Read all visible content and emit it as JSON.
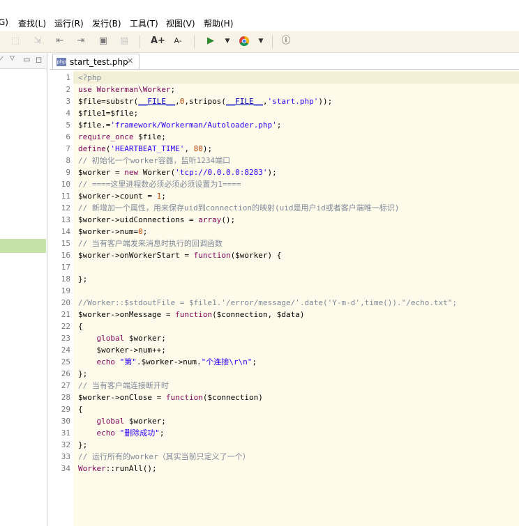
{
  "menu": {
    "items": [
      "G)",
      "查找(L)",
      "运行(R)",
      "发行(B)",
      "工具(T)",
      "视图(V)",
      "帮助(H)"
    ]
  },
  "toolbar": {
    "icons": [
      "format-icon",
      "export-icon",
      "step-back-icon",
      "step-forward-icon",
      "save-page-icon",
      "save-disabled-icon",
      "font-larger-icon",
      "font-smaller-icon",
      "run-icon",
      "run-dropdown-icon",
      "browser-icon",
      "browser-dropdown-icon",
      "info-icon"
    ],
    "font_larger": "A+",
    "font_smaller": "A-"
  },
  "tab": {
    "file_name": "start_test.php",
    "file_type": "php",
    "close_glyph": "✕"
  },
  "editor": {
    "lines": [
      {
        "n": "1",
        "html": "<span class='cmt-gray'>&lt;?php</span>"
      },
      {
        "n": "2",
        "html": "<span class='kw'>use</span> <span class='cls'>Workerman\\Worker</span>;"
      },
      {
        "n": "3",
        "html": "$file=substr(<span class='const'>__FILE__</span>,<span class='num'>0</span>,stripos(<span class='const'>__FILE__</span>,<span class='str'>'start.php'</span>));"
      },
      {
        "n": "4",
        "html": "$file1=$file;"
      },
      {
        "n": "5",
        "html": "$file.=<span class='str'>'framework/Workerman/Autoloader.php'</span>;"
      },
      {
        "n": "6",
        "html": "<span class='kw'>require_once</span> $file;"
      },
      {
        "n": "7",
        "html": "<span class='kw'>define</span>(<span class='str'>'HEARTBEAT_TIME'</span>, <span class='num'>80</span>);"
      },
      {
        "n": "8",
        "html": "<span class='cmt-gray'>// 初始化一个worker容器，监听1234端口</span>"
      },
      {
        "n": "9",
        "html": "$worker = <span class='kw'>new</span> Worker(<span class='str'>'tcp://0.0.0.0:8283'</span>);"
      },
      {
        "n": "10",
        "html": "<span class='cmt-gray'>// ====这里进程数必须必须必须设置为1====</span>"
      },
      {
        "n": "11",
        "html": "$worker-&gt;count = <span class='num'>1</span>;"
      },
      {
        "n": "12",
        "html": "<span class='cmt-gray'>// 新增加一个属性，用来保存uid到connection的映射(uid是用户id或者客户端唯一标识)</span>"
      },
      {
        "n": "13",
        "html": "$worker-&gt;uidConnections = <span class='kw'>array</span>();"
      },
      {
        "n": "14",
        "html": "$worker-&gt;num=<span class='num'>0</span>;"
      },
      {
        "n": "15",
        "html": "<span class='cmt-gray'>// 当有客户端发来消息时执行的回调函数</span>"
      },
      {
        "n": "16",
        "html": "$worker-&gt;onWorkerStart = <span class='kw'>function</span>($worker) {"
      },
      {
        "n": "17",
        "html": ""
      },
      {
        "n": "18",
        "html": "};"
      },
      {
        "n": "19",
        "html": ""
      },
      {
        "n": "20",
        "html": "<span class='cmt-gray'>//Worker::$stdoutFile = $file1.'/error/message/'.date('Y-m-d',time()).\"/echo.txt\";</span>"
      },
      {
        "n": "21",
        "html": "$worker-&gt;onMessage = <span class='kw'>function</span>($connection, $data)"
      },
      {
        "n": "22",
        "html": "{"
      },
      {
        "n": "23",
        "html": "    <span class='kw'>global</span> $worker;"
      },
      {
        "n": "24",
        "html": "    $worker-&gt;num++;"
      },
      {
        "n": "25",
        "html": "    <span class='kw'>echo</span> <span class='str'>\"第\"</span>.$worker-&gt;num.<span class='str'>\"个连接\\r\\n\"</span>;"
      },
      {
        "n": "26",
        "html": "};"
      },
      {
        "n": "27",
        "html": "<span class='cmt-gray'>// 当有客户端连接断开时</span>"
      },
      {
        "n": "28",
        "html": "$worker-&gt;onClose = <span class='kw'>function</span>($connection)"
      },
      {
        "n": "29",
        "html": "{"
      },
      {
        "n": "30",
        "html": "    <span class='kw'>global</span> $worker;"
      },
      {
        "n": "31",
        "html": "    <span class='kw'>echo</span> <span class='str'>\"删除成功\"</span>;"
      },
      {
        "n": "32",
        "html": "};"
      },
      {
        "n": "33",
        "html": "<span class='cmt-gray'>// 运行所有的worker（其实当前只定义了一个）</span>"
      },
      {
        "n": "34",
        "html": "<span class='cls'>Worker</span>::runAll();"
      }
    ]
  },
  "left_panel": {
    "icons": [
      "pin-icon",
      "view-menu-icon",
      "minimize-icon",
      "maximize-icon"
    ]
  }
}
